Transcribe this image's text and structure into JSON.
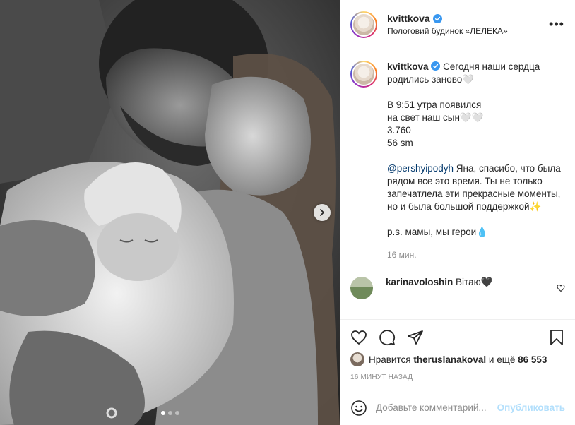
{
  "header": {
    "username": "kvittkova",
    "location": "Пологовий будинок «ЛЕЛЕКА»",
    "more": "•••"
  },
  "caption": {
    "username": "kvittkova",
    "line1": "Сегодня наши сердца родились заново🤍",
    "line2": "В 9:51 утра появился",
    "line3": "на свет наш сын🤍🤍",
    "line4": "3.760",
    "line5": "56 sm",
    "mention": "@pershyipodyh",
    "line6": " Яна, спасибо, что была рядом все это время. Ты не только запечатлела эти прекрасные моменты, но и была большой поддержкой✨",
    "line7": "p.s. мамы, мы герои💧",
    "time": "16 мин."
  },
  "comment": {
    "username": "karinavoloshin",
    "text": "Вітаю🖤"
  },
  "likes": {
    "prefix": "Нравится",
    "user": "theruslanakoval",
    "suffix": "и ещё",
    "count": "86 553"
  },
  "posted_ago": "16 МИНУТ НАЗАД",
  "add_comment": {
    "placeholder": "Добавьте комментарий...",
    "publish": "Опубликовать"
  },
  "colors": {
    "verified": "#3897f0",
    "link": "#00376b",
    "publish": "#b2dffc"
  },
  "carousel": {
    "slides": 3,
    "active_index": 0
  }
}
